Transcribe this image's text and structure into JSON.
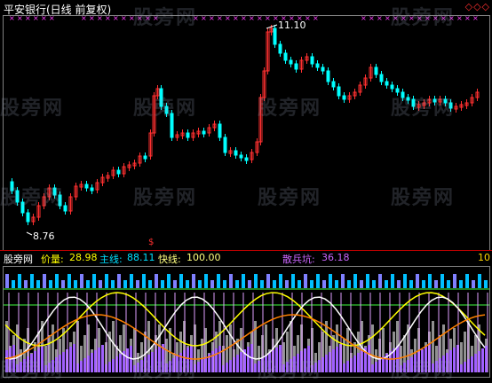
{
  "header": {
    "title": "平安银行(日线 前复权)",
    "controls": "◇◇◇"
  },
  "price_panel": {
    "high_label": "11.10",
    "low_label": "8.76",
    "signal_mark": "$"
  },
  "indicator": {
    "name": "股旁网",
    "items": [
      {
        "label": "价量:",
        "value": "28.98",
        "color": "#ffff00"
      },
      {
        "label": "主线:",
        "value": "88.11",
        "color": "#00e0ff"
      },
      {
        "label": "快线:",
        "value": "100.00",
        "color": "#ffff80"
      },
      {
        "label": "散兵坑:",
        "value": "36.18",
        "color": "#cc66ff"
      }
    ],
    "right_value": "10"
  },
  "watermark_text": "股旁网",
  "colors": {
    "up": "#ff3030",
    "down": "#00ffff",
    "magenta": "#ff40ff",
    "yellow": "#ffff00",
    "orange": "#ff8000",
    "grid": "#606060"
  }
}
